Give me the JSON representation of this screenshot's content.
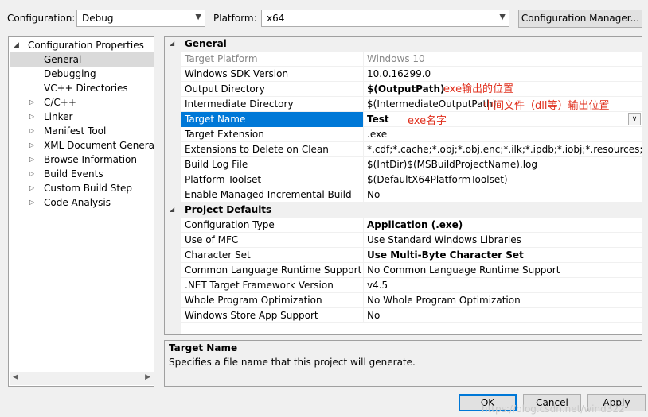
{
  "toolbar": {
    "configuration_label": "Configuration:",
    "configuration_value": "Debug",
    "platform_label": "Platform:",
    "platform_value": "x64",
    "config_manager_label": "Configuration Manager..."
  },
  "tree": {
    "root": "Configuration Properties",
    "items": [
      {
        "label": "General",
        "selected": true,
        "expandable": false
      },
      {
        "label": "Debugging",
        "expandable": false
      },
      {
        "label": "VC++ Directories",
        "expandable": false
      },
      {
        "label": "C/C++",
        "expandable": true
      },
      {
        "label": "Linker",
        "expandable": true
      },
      {
        "label": "Manifest Tool",
        "expandable": true
      },
      {
        "label": "XML Document Generator",
        "expandable": true
      },
      {
        "label": "Browse Information",
        "expandable": true
      },
      {
        "label": "Build Events",
        "expandable": true
      },
      {
        "label": "Custom Build Step",
        "expandable": true
      },
      {
        "label": "Code Analysis",
        "expandable": true
      }
    ]
  },
  "grid": {
    "sections": [
      {
        "title": "General",
        "rows": [
          {
            "name": "Target Platform",
            "value": "Windows 10",
            "dim": true
          },
          {
            "name": "Windows SDK Version",
            "value": "10.0.16299.0"
          },
          {
            "name": "Output Directory",
            "value": "$(OutputPath)",
            "bold": true
          },
          {
            "name": "Intermediate Directory",
            "value": "$(IntermediateOutputPath)"
          },
          {
            "name": "Target Name",
            "value": "Test",
            "bold": true,
            "selected": true
          },
          {
            "name": "Target Extension",
            "value": ".exe"
          },
          {
            "name": "Extensions to Delete on Clean",
            "value": "*.cdf;*.cache;*.obj;*.obj.enc;*.ilk;*.ipdb;*.iobj;*.resources;*.tlb;*.tli;*"
          },
          {
            "name": "Build Log File",
            "value": "$(IntDir)$(MSBuildProjectName).log"
          },
          {
            "name": "Platform Toolset",
            "value": "$(DefaultX64PlatformToolset)"
          },
          {
            "name": "Enable Managed Incremental Build",
            "value": "No"
          }
        ]
      },
      {
        "title": "Project Defaults",
        "rows": [
          {
            "name": "Configuration Type",
            "value": "Application (.exe)",
            "bold": true
          },
          {
            "name": "Use of MFC",
            "value": "Use Standard Windows Libraries"
          },
          {
            "name": "Character Set",
            "value": "Use Multi-Byte Character Set",
            "bold": true
          },
          {
            "name": "Common Language Runtime Support",
            "value": "No Common Language Runtime Support"
          },
          {
            "name": ".NET Target Framework Version",
            "value": "v4.5"
          },
          {
            "name": "Whole Program Optimization",
            "value": "No Whole Program Optimization"
          },
          {
            "name": "Windows Store App Support",
            "value": "No"
          }
        ]
      }
    ]
  },
  "annotations": {
    "output_dir": "exe输出的位置",
    "intermediate_dir": "中间文件（dll等）输出位置",
    "target_name": "exe名字"
  },
  "description": {
    "title": "Target Name",
    "text": "Specifies a file name that this project will generate."
  },
  "buttons": {
    "ok": "OK",
    "cancel": "Cancel",
    "apply": "Apply"
  },
  "watermark": "https://blog.csdn.net/wind322",
  "colors": {
    "selection": "#0078d7",
    "annotation": "#e0301e"
  }
}
